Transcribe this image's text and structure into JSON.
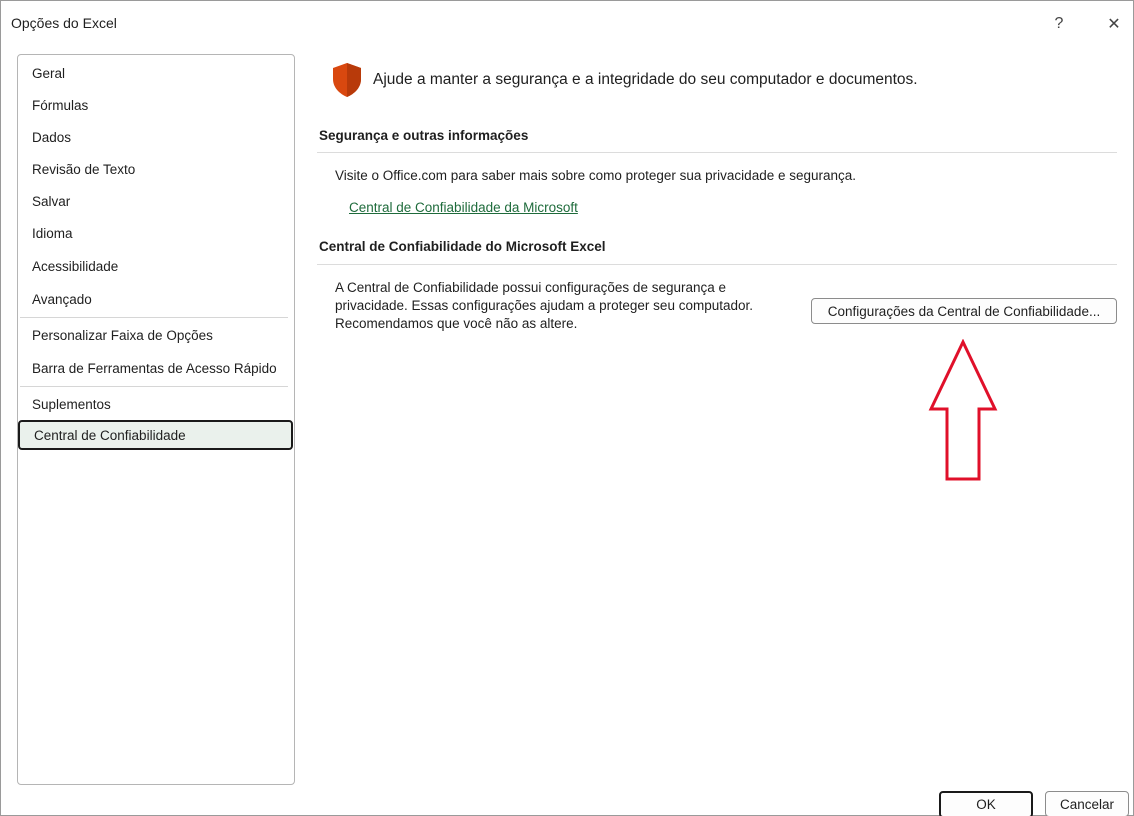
{
  "window": {
    "title": "Opções do Excel",
    "help_label": "?",
    "close_label": "✕"
  },
  "sidebar": {
    "items": [
      {
        "label": "Geral"
      },
      {
        "label": "Fórmulas"
      },
      {
        "label": "Dados"
      },
      {
        "label": "Revisão de Texto"
      },
      {
        "label": "Salvar"
      },
      {
        "label": "Idioma"
      },
      {
        "label": "Acessibilidade"
      },
      {
        "label": "Avançado"
      },
      {
        "label": "Personalizar Faixa de Opções"
      },
      {
        "label": "Barra de Ferramentas de Acesso Rápido"
      },
      {
        "label": "Suplementos"
      },
      {
        "label": "Central de Confiabilidade",
        "selected": true
      }
    ]
  },
  "main": {
    "hero_text": "Ajude a manter a segurança e a integridade do seu computador e documentos.",
    "section1": {
      "title": "Segurança e outras informações",
      "text": "Visite o Office.com para saber mais sobre como proteger sua privacidade e segurança.",
      "link": "Central de Confiabilidade da Microsoft"
    },
    "section2": {
      "title": "Central de Confiabilidade do Microsoft Excel",
      "line1": "A Central de Confiabilidade possui configurações de segurança e",
      "line2": "privacidade. Essas configurações ajudam a proteger seu computador.",
      "line3": "Recomendamos que você não as altere.",
      "button_label": "Configurações da Central de Confiabilidade..."
    }
  },
  "footer": {
    "ok_label": "OK",
    "cancel_label": "Cancelar"
  },
  "colors": {
    "shield": "#d9480f",
    "link": "#1e6b3b",
    "annotation_arrow": "#e0102a",
    "selected_bg": "#eaf1ec"
  }
}
